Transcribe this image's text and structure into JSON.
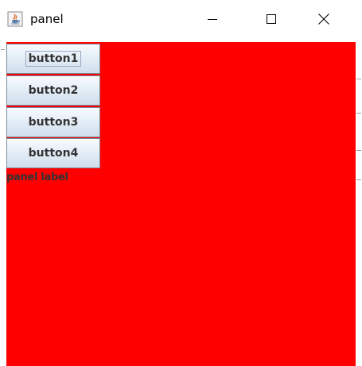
{
  "window": {
    "title": "panel",
    "icon": "java-coffee-icon",
    "controls": {
      "minimize_icon": "minimize-icon",
      "maximize_icon": "maximize-icon",
      "close_icon": "close-icon"
    }
  },
  "panel": {
    "background_color": "#ff0000",
    "buttons": [
      {
        "label": "button1",
        "focused": true
      },
      {
        "label": "button2",
        "focused": false
      },
      {
        "label": "button3",
        "focused": false
      },
      {
        "label": "button4",
        "focused": false
      }
    ],
    "label": "panel label"
  },
  "colors": {
    "panel_background": "#ff0000",
    "button_text": "#333333",
    "title_text": "#000000"
  }
}
